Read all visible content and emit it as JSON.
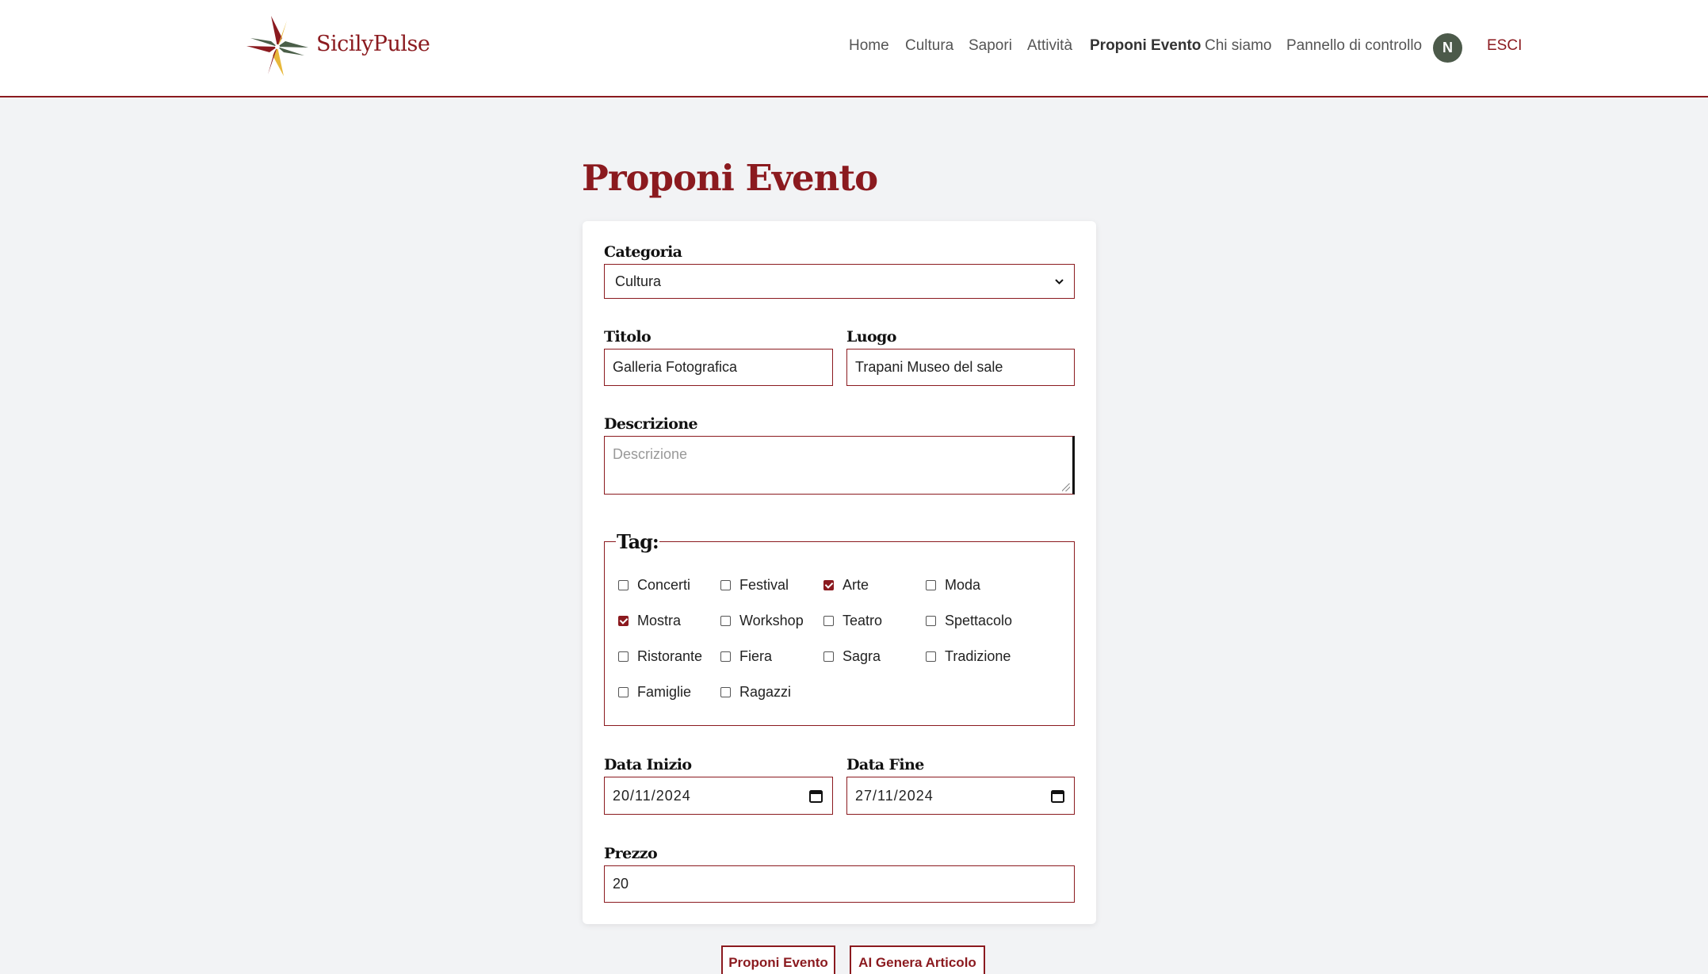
{
  "brand": {
    "name": "SicilyPulse"
  },
  "nav": {
    "home": "Home",
    "cultura": "Cultura",
    "sapori": "Sapori",
    "attivita": "Attività",
    "proponi": "Proponi Evento",
    "chi_siamo": "Chi siamo",
    "pannello": "Pannello di controllo",
    "avatar_initial": "N",
    "logout": "ESCI"
  },
  "page": {
    "title": "Proponi Evento"
  },
  "form": {
    "categoria": {
      "label": "Categoria",
      "value": "Cultura"
    },
    "titolo": {
      "label": "Titolo",
      "value": "Galleria Fotografica"
    },
    "luogo": {
      "label": "Luogo",
      "value": "Trapani Museo del sale"
    },
    "descrizione": {
      "label": "Descrizione",
      "placeholder": "Descrizione",
      "value": ""
    },
    "tags": {
      "legend": "Tag:",
      "items": [
        {
          "label": "Concerti",
          "checked": false
        },
        {
          "label": "Festival",
          "checked": false
        },
        {
          "label": "Arte",
          "checked": true
        },
        {
          "label": "Moda",
          "checked": false
        },
        {
          "label": "Mostra",
          "checked": true
        },
        {
          "label": "Workshop",
          "checked": false
        },
        {
          "label": "Teatro",
          "checked": false
        },
        {
          "label": "Spettacolo",
          "checked": false
        },
        {
          "label": "Ristorante",
          "checked": false
        },
        {
          "label": "Fiera",
          "checked": false
        },
        {
          "label": "Sagra",
          "checked": false
        },
        {
          "label": "Tradizione",
          "checked": false
        },
        {
          "label": "Famiglie",
          "checked": false
        },
        {
          "label": "Ragazzi",
          "checked": false
        }
      ]
    },
    "data_inizio": {
      "label": "Data Inizio",
      "value": "20/11/2024"
    },
    "data_fine": {
      "label": "Data Fine",
      "value": "27/11/2024"
    },
    "prezzo": {
      "label": "Prezzo",
      "value": "20"
    }
  },
  "actions": {
    "submit": "Proponi Evento",
    "ai": "AI Genera Articolo"
  },
  "colors": {
    "accent": "#8b1a1f",
    "avatar_bg": "#4c5a4a",
    "page_bg": "#f2f3f5",
    "logo_green": "#4a5e48",
    "logo_gold": "#e8b83a"
  }
}
